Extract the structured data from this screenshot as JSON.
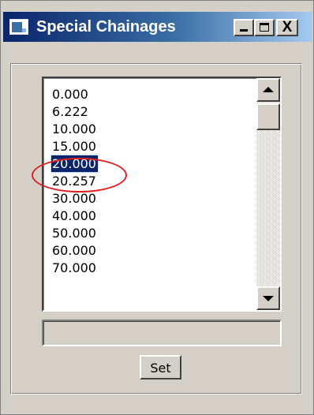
{
  "window": {
    "title": "Special Chainages",
    "close_label": "X"
  },
  "list": {
    "items": [
      "0.000",
      "6.222",
      "10.000",
      "15.000",
      "20.000",
      "20.257",
      "30.000",
      "40.000",
      "50.000",
      "60.000",
      "70.000"
    ],
    "selected_index": 4
  },
  "text_field": {
    "value": ""
  },
  "buttons": {
    "set_label": "Set"
  },
  "icons": {
    "app": "app-window-icon",
    "minimize": "minimize-icon",
    "maximize": "maximize-icon",
    "close": "close-icon",
    "scroll_up": "arrow-up-icon",
    "scroll_down": "arrow-down-icon"
  },
  "colors": {
    "selection": "#0a246a",
    "annotation": "#e02020",
    "titlebar_start": "#0a246a",
    "titlebar_end": "#a6caf0"
  }
}
